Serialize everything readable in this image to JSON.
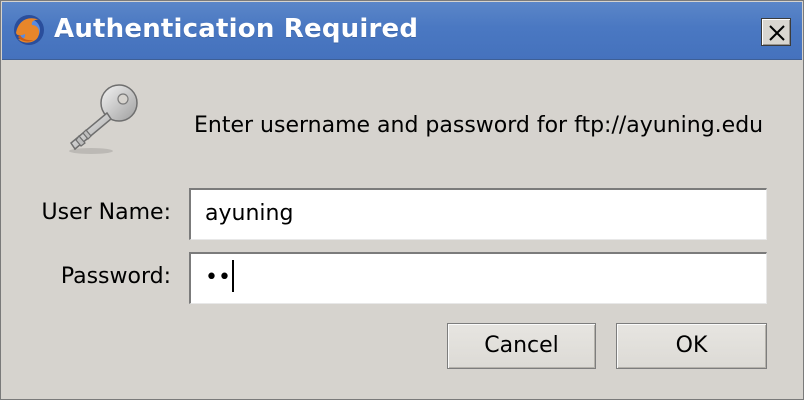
{
  "window": {
    "title": "Authentication Required",
    "app_icon": "firefox-icon",
    "close_icon": "close-icon"
  },
  "dialog": {
    "icon": "key-icon",
    "message": "Enter username and password for ftp://ayuning.edu",
    "username_label": "User Name:",
    "username_value": "ayuning",
    "password_label": "Password:",
    "password_masked": "••",
    "buttons": {
      "cancel": "Cancel",
      "ok": "OK"
    }
  },
  "colors": {
    "titlebar": "#4a78c2",
    "window_bg": "#d6d3ce",
    "field_bg": "#ffffff"
  }
}
